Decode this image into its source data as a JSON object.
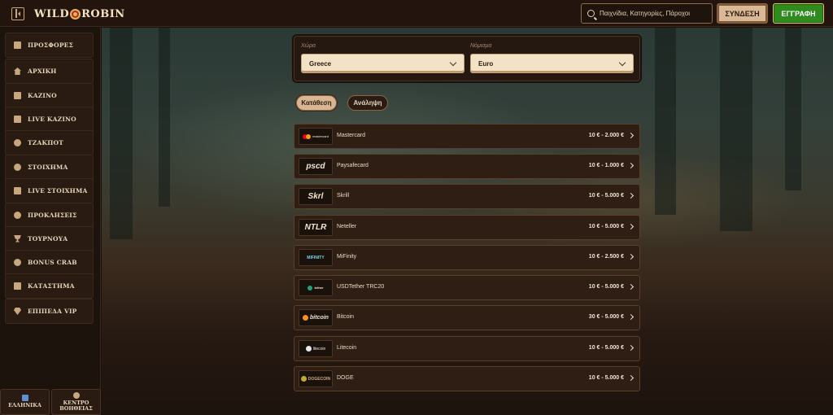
{
  "header": {
    "logo_left": "WILD",
    "logo_right": "ROBIN",
    "search_placeholder": "Παιχνίδια, Κατηγορίες, Πάροχοι",
    "login_label": "ΣΥΝΔΕΣΗ",
    "register_label": "ΕΓΓΡΑΦΗ"
  },
  "sidebar": {
    "groups": [
      [
        "ΠΡΟΣΦΟΡΕΣ"
      ],
      [
        "ΑΡΧΙΚΗ"
      ],
      [
        "ΚΑΖΙΝΟ",
        "LIVE ΚΑΖΙΝΟ",
        "ΤΖΑΚΠΟΤ"
      ],
      [
        "ΣΤΟΙΧΗΜΑ",
        "LIVE ΣΤΟΙΧΗΜΑ"
      ],
      [
        "ΠΡΟΚΛΗΣΕΙΣ",
        "ΤΟΥΡΝΟΥΑ",
        "BONUS CRAB",
        "ΚΑΤΑΣΤΗΜΑ"
      ],
      [
        "ΕΠΙΠΕΔΑ VIP"
      ]
    ],
    "language_label": "ΕΛΛΗΝΙΚΑ",
    "help_line1": "ΚΕΝΤΡΟ",
    "help_line2": "ΒΟΗΘΕΙΑΣ"
  },
  "filters": {
    "country_label": "Χώρα",
    "country_value": "Greece",
    "currency_label": "Νόμισμα",
    "currency_value": "Euro"
  },
  "tabs": {
    "deposit": "Κατάθεση",
    "withdraw": "Ανάληψη"
  },
  "payments": [
    {
      "logo": "mastercard",
      "name": "Mastercard",
      "range": "10 € - 2.000 €"
    },
    {
      "logo": "pscd",
      "name": "Paysafecard",
      "range": "10 € - 1.000 €"
    },
    {
      "logo": "Skrl",
      "name": "Skrill",
      "range": "10 € - 5.000 €"
    },
    {
      "logo": "NTLR",
      "name": "Neteller",
      "range": "10 € - 5.000 €"
    },
    {
      "logo": "MIFINITY",
      "name": "MiFinity",
      "range": "10 € - 2.500 €"
    },
    {
      "logo": "tether",
      "name": "USDTether TRC20",
      "range": "10 € - 5.000 €"
    },
    {
      "logo": "bitcoin",
      "name": "Bitcoin",
      "range": "30 € - 5.000 €"
    },
    {
      "logo": "litecoin",
      "name": "Litecoin",
      "range": "10 € - 5.000 €"
    },
    {
      "logo": "DOGECOIN",
      "name": "DOGE",
      "range": "10 € - 5.000 €"
    }
  ]
}
